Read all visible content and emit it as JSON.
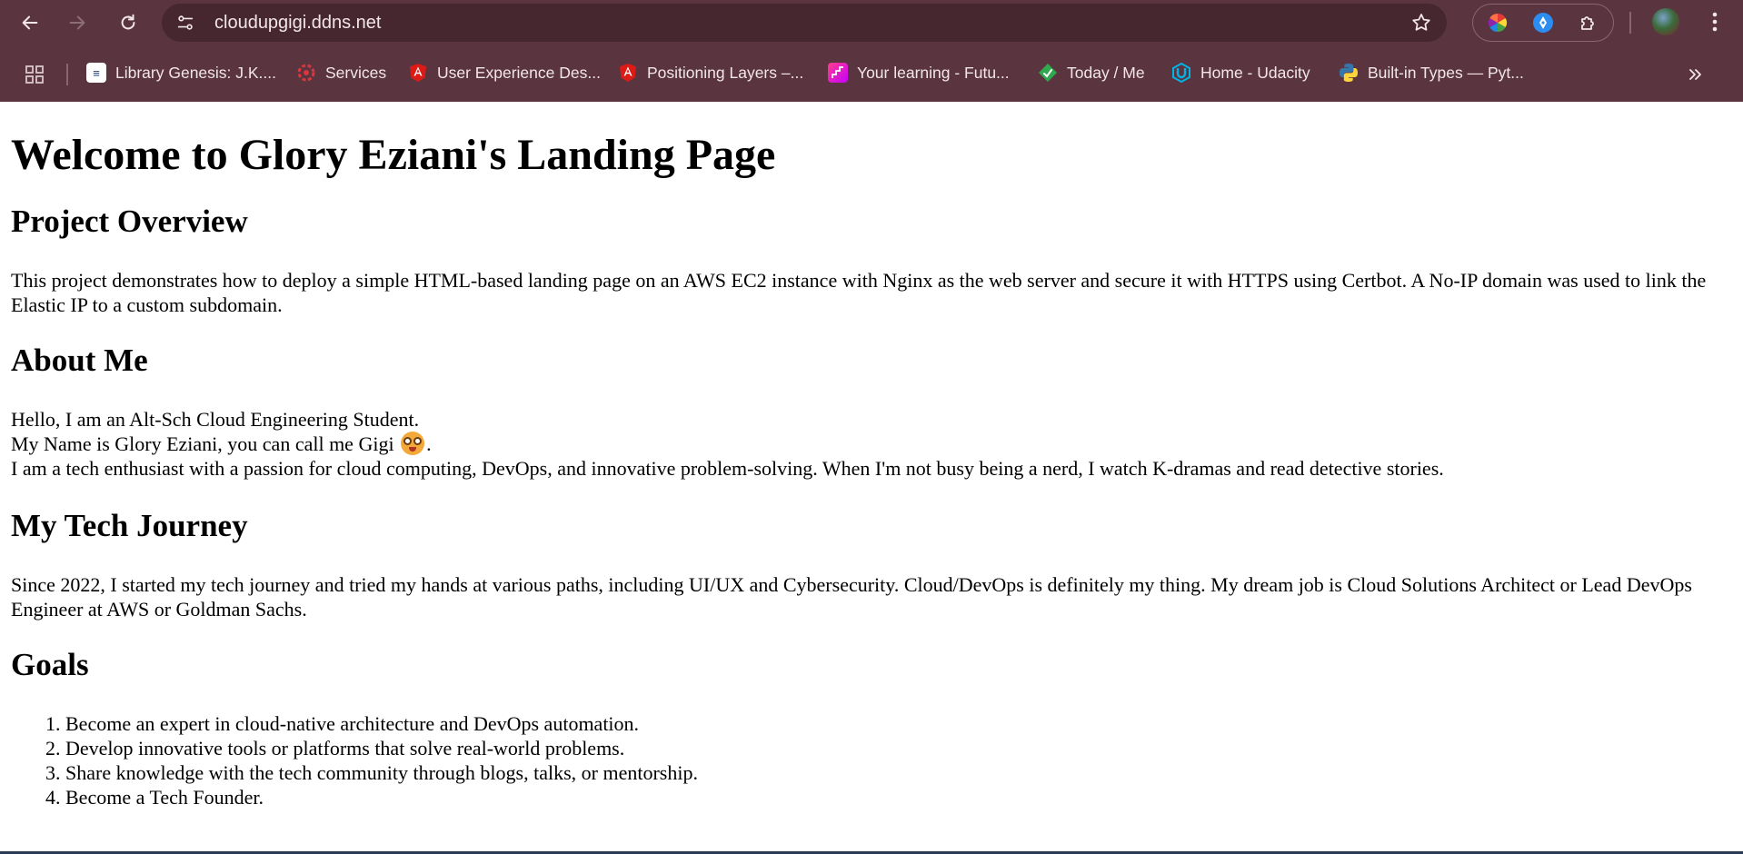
{
  "browser": {
    "url": "cloudupgigi.ddns.net",
    "bookmarks": [
      {
        "label": "Library Genesis: J.K....",
        "icon": "library-genesis-icon",
        "color": "#ffffff"
      },
      {
        "label": "Services",
        "icon": "services-icon",
        "color": "#d9363e"
      },
      {
        "label": "User Experience Des...",
        "icon": "angular-icon",
        "color": "#dd1b16"
      },
      {
        "label": "Positioning Layers –...",
        "icon": "angular-icon",
        "color": "#dd1b16"
      },
      {
        "label": "Your learning - Futu...",
        "icon": "futurelearn-icon",
        "color": "#e6007e"
      },
      {
        "label": "Today / Me",
        "icon": "today-icon",
        "color": "#2fa84f"
      },
      {
        "label": "Home - Udacity",
        "icon": "udacity-icon",
        "color": "#02b3e4"
      },
      {
        "label": "Built-in Types — Pyt...",
        "icon": "python-icon",
        "color": "#3776ab"
      }
    ]
  },
  "page": {
    "title": "Welcome to Glory Eziani's Landing Page",
    "overview": {
      "heading": "Project Overview",
      "text": "This project demonstrates how to deploy a simple HTML-based landing page on an AWS EC2 instance with Nginx as the web server and secure it with HTTPS using Certbot. A No-IP domain was used to link the Elastic IP to a custom subdomain."
    },
    "about": {
      "heading": "About Me",
      "line1": "Hello, I am an Alt-Sch Cloud Engineering Student.",
      "line2": "My Name is Glory Eziani, you can call me Gigi",
      "line2_end": ".",
      "line3": "I am a tech enthusiast with a passion for cloud computing, DevOps, and innovative problem-solving. When I'm not busy being a nerd, I watch K-dramas and read detective stories."
    },
    "journey": {
      "heading": "My Tech Journey",
      "text": "Since 2022, I started my tech journey and tried my hands at various paths, including UI/UX and Cybersecurity. Cloud/DevOps is definitely my thing. My dream job is Cloud Solutions Architect or Lead DevOps Engineer at AWS or Goldman Sachs."
    },
    "goals": {
      "heading": "Goals",
      "items": [
        "Become an expert in cloud-native architecture and DevOps automation.",
        "Develop innovative tools or platforms that solve real-world problems.",
        "Share knowledge with the tech community through blogs, talks, or mentorship.",
        "Become a Tech Founder."
      ]
    }
  }
}
